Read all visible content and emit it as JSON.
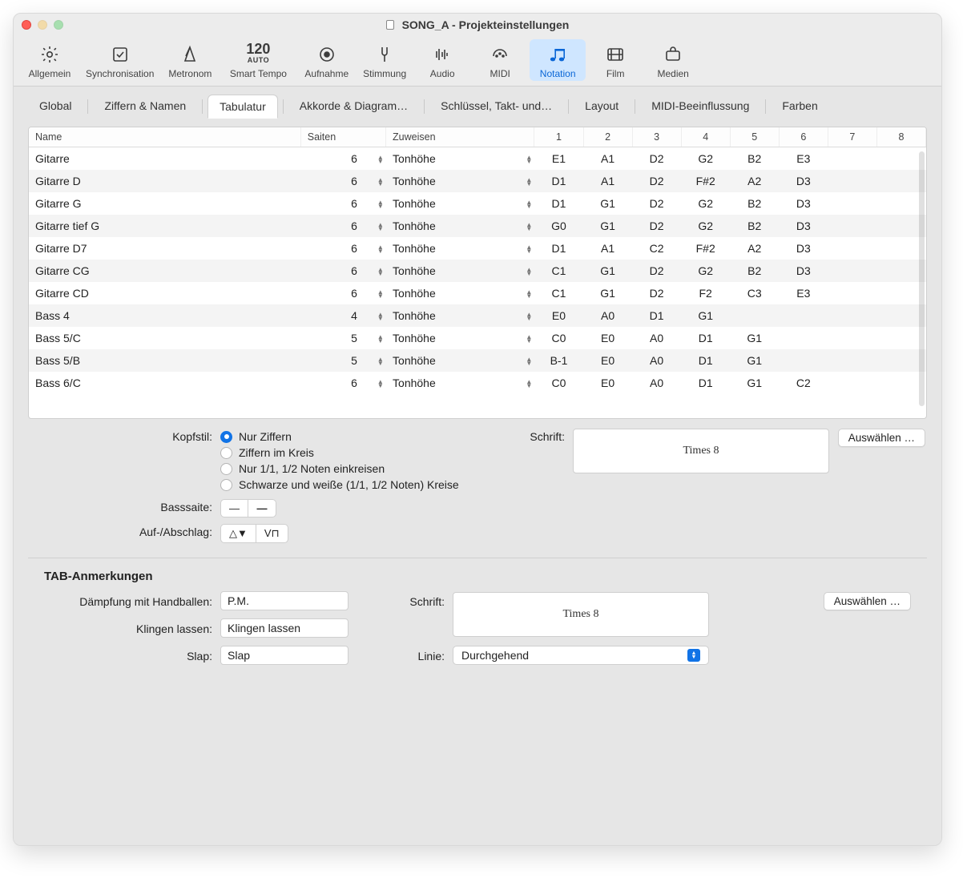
{
  "window": {
    "title": "SONG_A - Projekteinstellungen"
  },
  "toolbar": {
    "allgemein": "Allgemein",
    "sync": "Synchronisation",
    "metronom": "Metronom",
    "tempo_val": "120",
    "tempo_auto": "AUTO",
    "smart_tempo": "Smart Tempo",
    "aufnahme": "Aufnahme",
    "stimmung": "Stimmung",
    "audio": "Audio",
    "midi": "MIDI",
    "notation": "Notation",
    "film": "Film",
    "medien": "Medien"
  },
  "subtabs": {
    "global": "Global",
    "ziffern": "Ziffern & Namen",
    "tabulatur": "Tabulatur",
    "akkorde": "Akkorde & Diagram…",
    "schluessel": "Schlüssel, Takt- und…",
    "layout": "Layout",
    "midi_beeinflussung": "MIDI-Beeinflussung",
    "farben": "Farben"
  },
  "table": {
    "headers": {
      "name": "Name",
      "saiten": "Saiten",
      "zuweisen": "Zuweisen",
      "c1": "1",
      "c2": "2",
      "c3": "3",
      "c4": "4",
      "c5": "5",
      "c6": "6",
      "c7": "7",
      "c8": "8"
    },
    "rows": [
      {
        "name": "Gitarre",
        "saiten": "6",
        "zuw": "Tonhöhe",
        "n": [
          "E1",
          "A1",
          "D2",
          "G2",
          "B2",
          "E3",
          "",
          ""
        ]
      },
      {
        "name": "Gitarre D",
        "saiten": "6",
        "zuw": "Tonhöhe",
        "n": [
          "D1",
          "A1",
          "D2",
          "F#2",
          "A2",
          "D3",
          "",
          ""
        ]
      },
      {
        "name": "Gitarre G",
        "saiten": "6",
        "zuw": "Tonhöhe",
        "n": [
          "D1",
          "G1",
          "D2",
          "G2",
          "B2",
          "D3",
          "",
          ""
        ]
      },
      {
        "name": "Gitarre tief G",
        "saiten": "6",
        "zuw": "Tonhöhe",
        "n": [
          "G0",
          "G1",
          "D2",
          "G2",
          "B2",
          "D3",
          "",
          ""
        ]
      },
      {
        "name": "Gitarre D7",
        "saiten": "6",
        "zuw": "Tonhöhe",
        "n": [
          "D1",
          "A1",
          "C2",
          "F#2",
          "A2",
          "D3",
          "",
          ""
        ]
      },
      {
        "name": "Gitarre CG",
        "saiten": "6",
        "zuw": "Tonhöhe",
        "n": [
          "C1",
          "G1",
          "D2",
          "G2",
          "B2",
          "D3",
          "",
          ""
        ]
      },
      {
        "name": "Gitarre CD",
        "saiten": "6",
        "zuw": "Tonhöhe",
        "n": [
          "C1",
          "G1",
          "D2",
          "F2",
          "C3",
          "E3",
          "",
          ""
        ]
      },
      {
        "name": "Bass 4",
        "saiten": "4",
        "zuw": "Tonhöhe",
        "n": [
          "E0",
          "A0",
          "D1",
          "G1",
          "",
          "",
          "",
          ""
        ]
      },
      {
        "name": "Bass 5/C",
        "saiten": "5",
        "zuw": "Tonhöhe",
        "n": [
          "C0",
          "E0",
          "A0",
          "D1",
          "G1",
          "",
          "",
          ""
        ]
      },
      {
        "name": "Bass 5/B",
        "saiten": "5",
        "zuw": "Tonhöhe",
        "n": [
          "B-1",
          "E0",
          "A0",
          "D1",
          "G1",
          "",
          "",
          ""
        ]
      },
      {
        "name": "Bass 6/C",
        "saiten": "6",
        "zuw": "Tonhöhe",
        "n": [
          "C0",
          "E0",
          "A0",
          "D1",
          "G1",
          "C2",
          "",
          ""
        ]
      }
    ]
  },
  "mid": {
    "kopfstil_label": "Kopfstil:",
    "kopfstil_opts": {
      "o1": "Nur Ziffern",
      "o2": "Ziffern im Kreis",
      "o3": "Nur 1/1, 1/2 Noten einkreisen",
      "o4": "Schwarze und weiße (1/1, 1/2 Noten) Kreise"
    },
    "schrift_label": "Schrift:",
    "font_preview": "Times 8",
    "auswahl_btn": "Auswählen …",
    "basssaite_label": "Basssaite:",
    "aufab_label": "Auf-/Abschlag:",
    "seg_bass_a": "—",
    "seg_bass_b": "—",
    "seg_strk_a": "△▼",
    "seg_strk_b": "V⊓"
  },
  "ann": {
    "title": "TAB-Anmerkungen",
    "damp_label": "Dämpfung mit Handballen:",
    "damp_val": "P.M.",
    "klingen_label": "Klingen lassen:",
    "klingen_val": "Klingen lassen",
    "slap_label": "Slap:",
    "slap_val": "Slap",
    "schrift_label": "Schrift:",
    "font_preview": "Times 8",
    "auswahl_btn": "Auswählen …",
    "linie_label": "Linie:",
    "linie_val": "Durchgehend"
  }
}
